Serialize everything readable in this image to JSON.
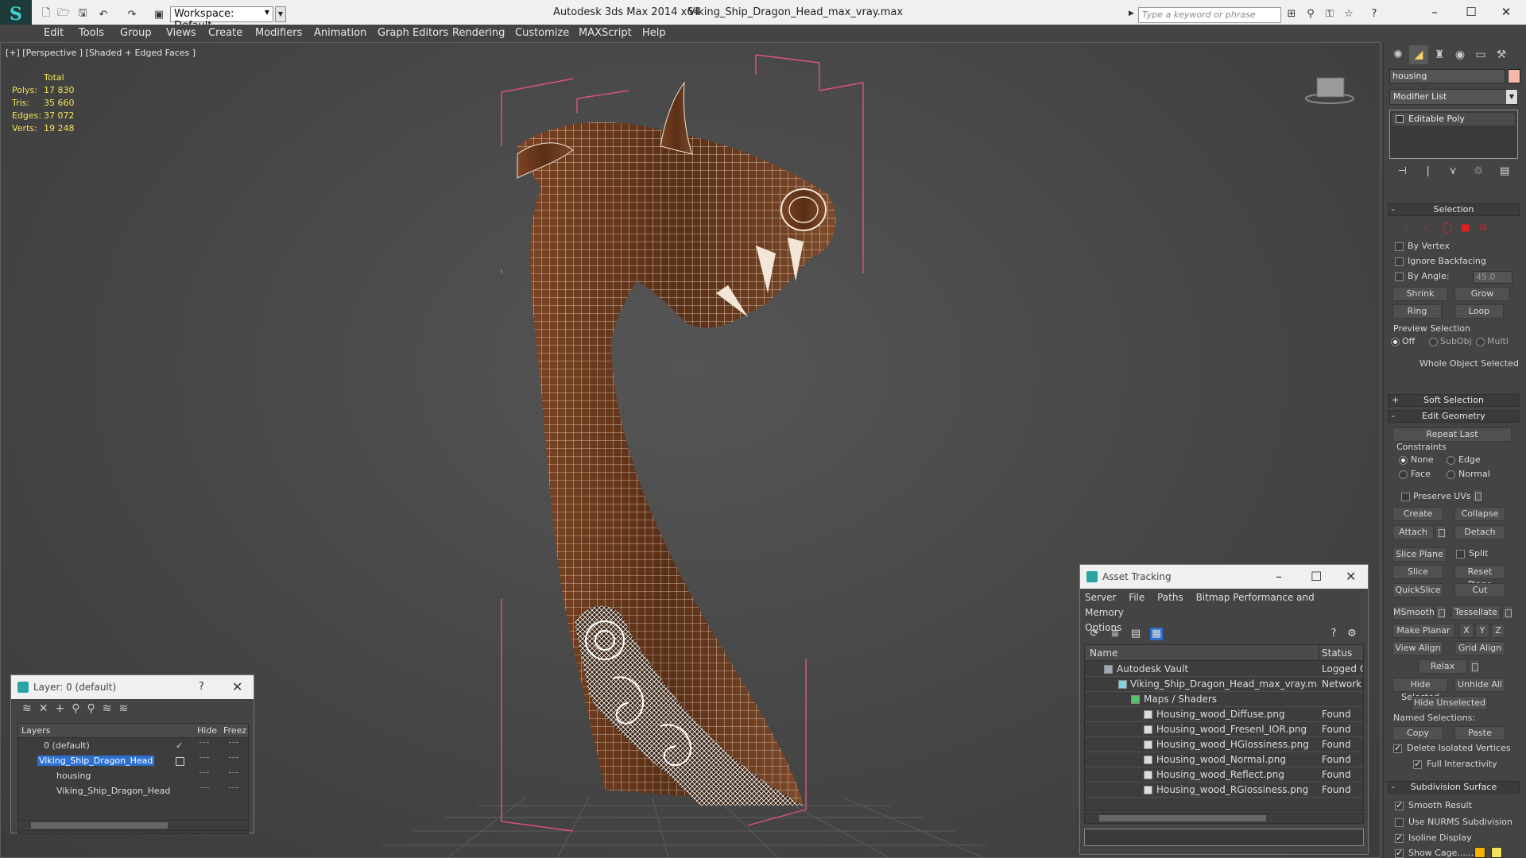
{
  "titlebar": {
    "workspace": "Workspace: Default",
    "app_title": "Autodesk 3ds Max  2014 x64",
    "file_title": "Viking_Ship_Dragon_Head_max_vray.max",
    "search_placeholder": "Type a keyword or phrase"
  },
  "menu": [
    "Edit",
    "Tools",
    "Group",
    "Views",
    "Create",
    "Modifiers",
    "Animation",
    "Graph Editors",
    "Rendering",
    "Customize",
    "MAXScript",
    "Help"
  ],
  "viewport": {
    "label": "[+] [Perspective ] [Shaded + Edged Faces ]",
    "stats": {
      "header": "Total",
      "rows": [
        {
          "k": "Polys:",
          "v": "17 830"
        },
        {
          "k": "Tris:",
          "v": "35 660"
        },
        {
          "k": "Edges:",
          "v": "37 072"
        },
        {
          "k": "Verts:",
          "v": "19 248"
        }
      ]
    }
  },
  "command_panel": {
    "object_name": "housing",
    "modifier_list": "Modifier List",
    "stack_item": "Editable Poly",
    "selection": {
      "title": "Selection",
      "by_vertex": "By Vertex",
      "ignore_backfacing": "Ignore Backfacing",
      "by_angle": "By Angle:",
      "angle_value": "45.0",
      "shrink": "Shrink",
      "grow": "Grow",
      "ring": "Ring",
      "loop": "Loop",
      "preview_selection": "Preview Selection",
      "off": "Off",
      "subobj": "SubObj",
      "multi": "Multi",
      "whole_object": "Whole Object Selected"
    },
    "soft_selection": "Soft Selection",
    "edit_geometry": {
      "title": "Edit Geometry",
      "repeat_last": "Repeat Last",
      "constraints": "Constraints",
      "none": "None",
      "edge": "Edge",
      "face": "Face",
      "normal": "Normal",
      "preserve_uvs": "Preserve UVs",
      "create": "Create",
      "collapse": "Collapse",
      "attach": "Attach",
      "detach": "Detach",
      "slice_plane": "Slice Plane",
      "split": "Split",
      "slice": "Slice",
      "reset_plane": "Reset Plane",
      "quickslice": "QuickSlice",
      "cut": "Cut",
      "msmooth": "MSmooth",
      "tessellate": "Tessellate",
      "make_planar": "Make Planar",
      "x": "X",
      "y": "Y",
      "z": "Z",
      "view_align": "View Align",
      "grid_align": "Grid Align",
      "relax": "Relax",
      "hide_selected": "Hide Selected",
      "unhide_all": "Unhide All",
      "hide_unselected": "Hide Unselected",
      "named_selections": "Named Selections:",
      "copy": "Copy",
      "paste": "Paste",
      "delete_isolated": "Delete Isolated Vertices",
      "full_interactivity": "Full Interactivity"
    },
    "subdivision": {
      "title": "Subdivision Surface",
      "smooth_result": "Smooth Result",
      "use_nurms": "Use NURMS Subdivision",
      "isoline": "Isoline Display",
      "show_cage": "Show Cage......"
    }
  },
  "layer_dialog": {
    "title": "Layer: 0 (default)",
    "help": "?",
    "col_layers": "Layers",
    "col_hide": "Hide",
    "col_freeze": "Freez",
    "rows": [
      {
        "name": "0 (default)"
      },
      {
        "name": "Viking_Ship_Dragon_Head"
      },
      {
        "name": "housing"
      },
      {
        "name": "Viking_Ship_Dragon_Head"
      }
    ]
  },
  "asset_dialog": {
    "title": "Asset Tracking",
    "menu": [
      "Server",
      "File",
      "Paths",
      "Bitmap Performance and Memory",
      "Options"
    ],
    "col_name": "Name",
    "col_status": "Status",
    "rows": [
      {
        "name": "Autodesk Vault",
        "status": "Logged Of"
      },
      {
        "name": "Viking_Ship_Dragon_Head_max_vray.max",
        "status": "Network P"
      },
      {
        "name": "Maps / Shaders",
        "status": ""
      },
      {
        "name": "Housing_wood_Diffuse.png",
        "status": "Found"
      },
      {
        "name": "Housing_wood_Fresenl_IOR.png",
        "status": "Found"
      },
      {
        "name": "Housing_wood_HGlossiness.png",
        "status": "Found"
      },
      {
        "name": "Housing_wood_Normal.png",
        "status": "Found"
      },
      {
        "name": "Housing_wood_Reflect.png",
        "status": "Found"
      },
      {
        "name": "Housing_wood_RGlossiness.png",
        "status": "Found"
      }
    ]
  },
  "colors": {
    "stats_yellow": "#f3e25a",
    "selection_blue": "#2c6fd1",
    "bbox_pink": "#e0508c",
    "wood": "#6b3a1f",
    "object_color": "#f5b8a7"
  }
}
